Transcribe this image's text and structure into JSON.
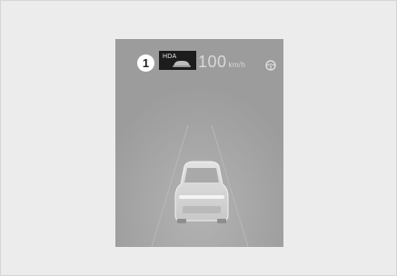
{
  "display": {
    "callout_number": "1",
    "hda_label": "HDA",
    "speed_value": "100",
    "speed_unit": "km/h",
    "icons": {
      "hda_car": "car-icon",
      "steering": "steering-wheel-icon",
      "vehicle": "vehicle-rear-icon"
    }
  },
  "colors": {
    "background": "#ececec",
    "display_bg": "#9c9c9c",
    "hda_box": "#1c1c1c",
    "text_light": "#d9d9d9"
  }
}
